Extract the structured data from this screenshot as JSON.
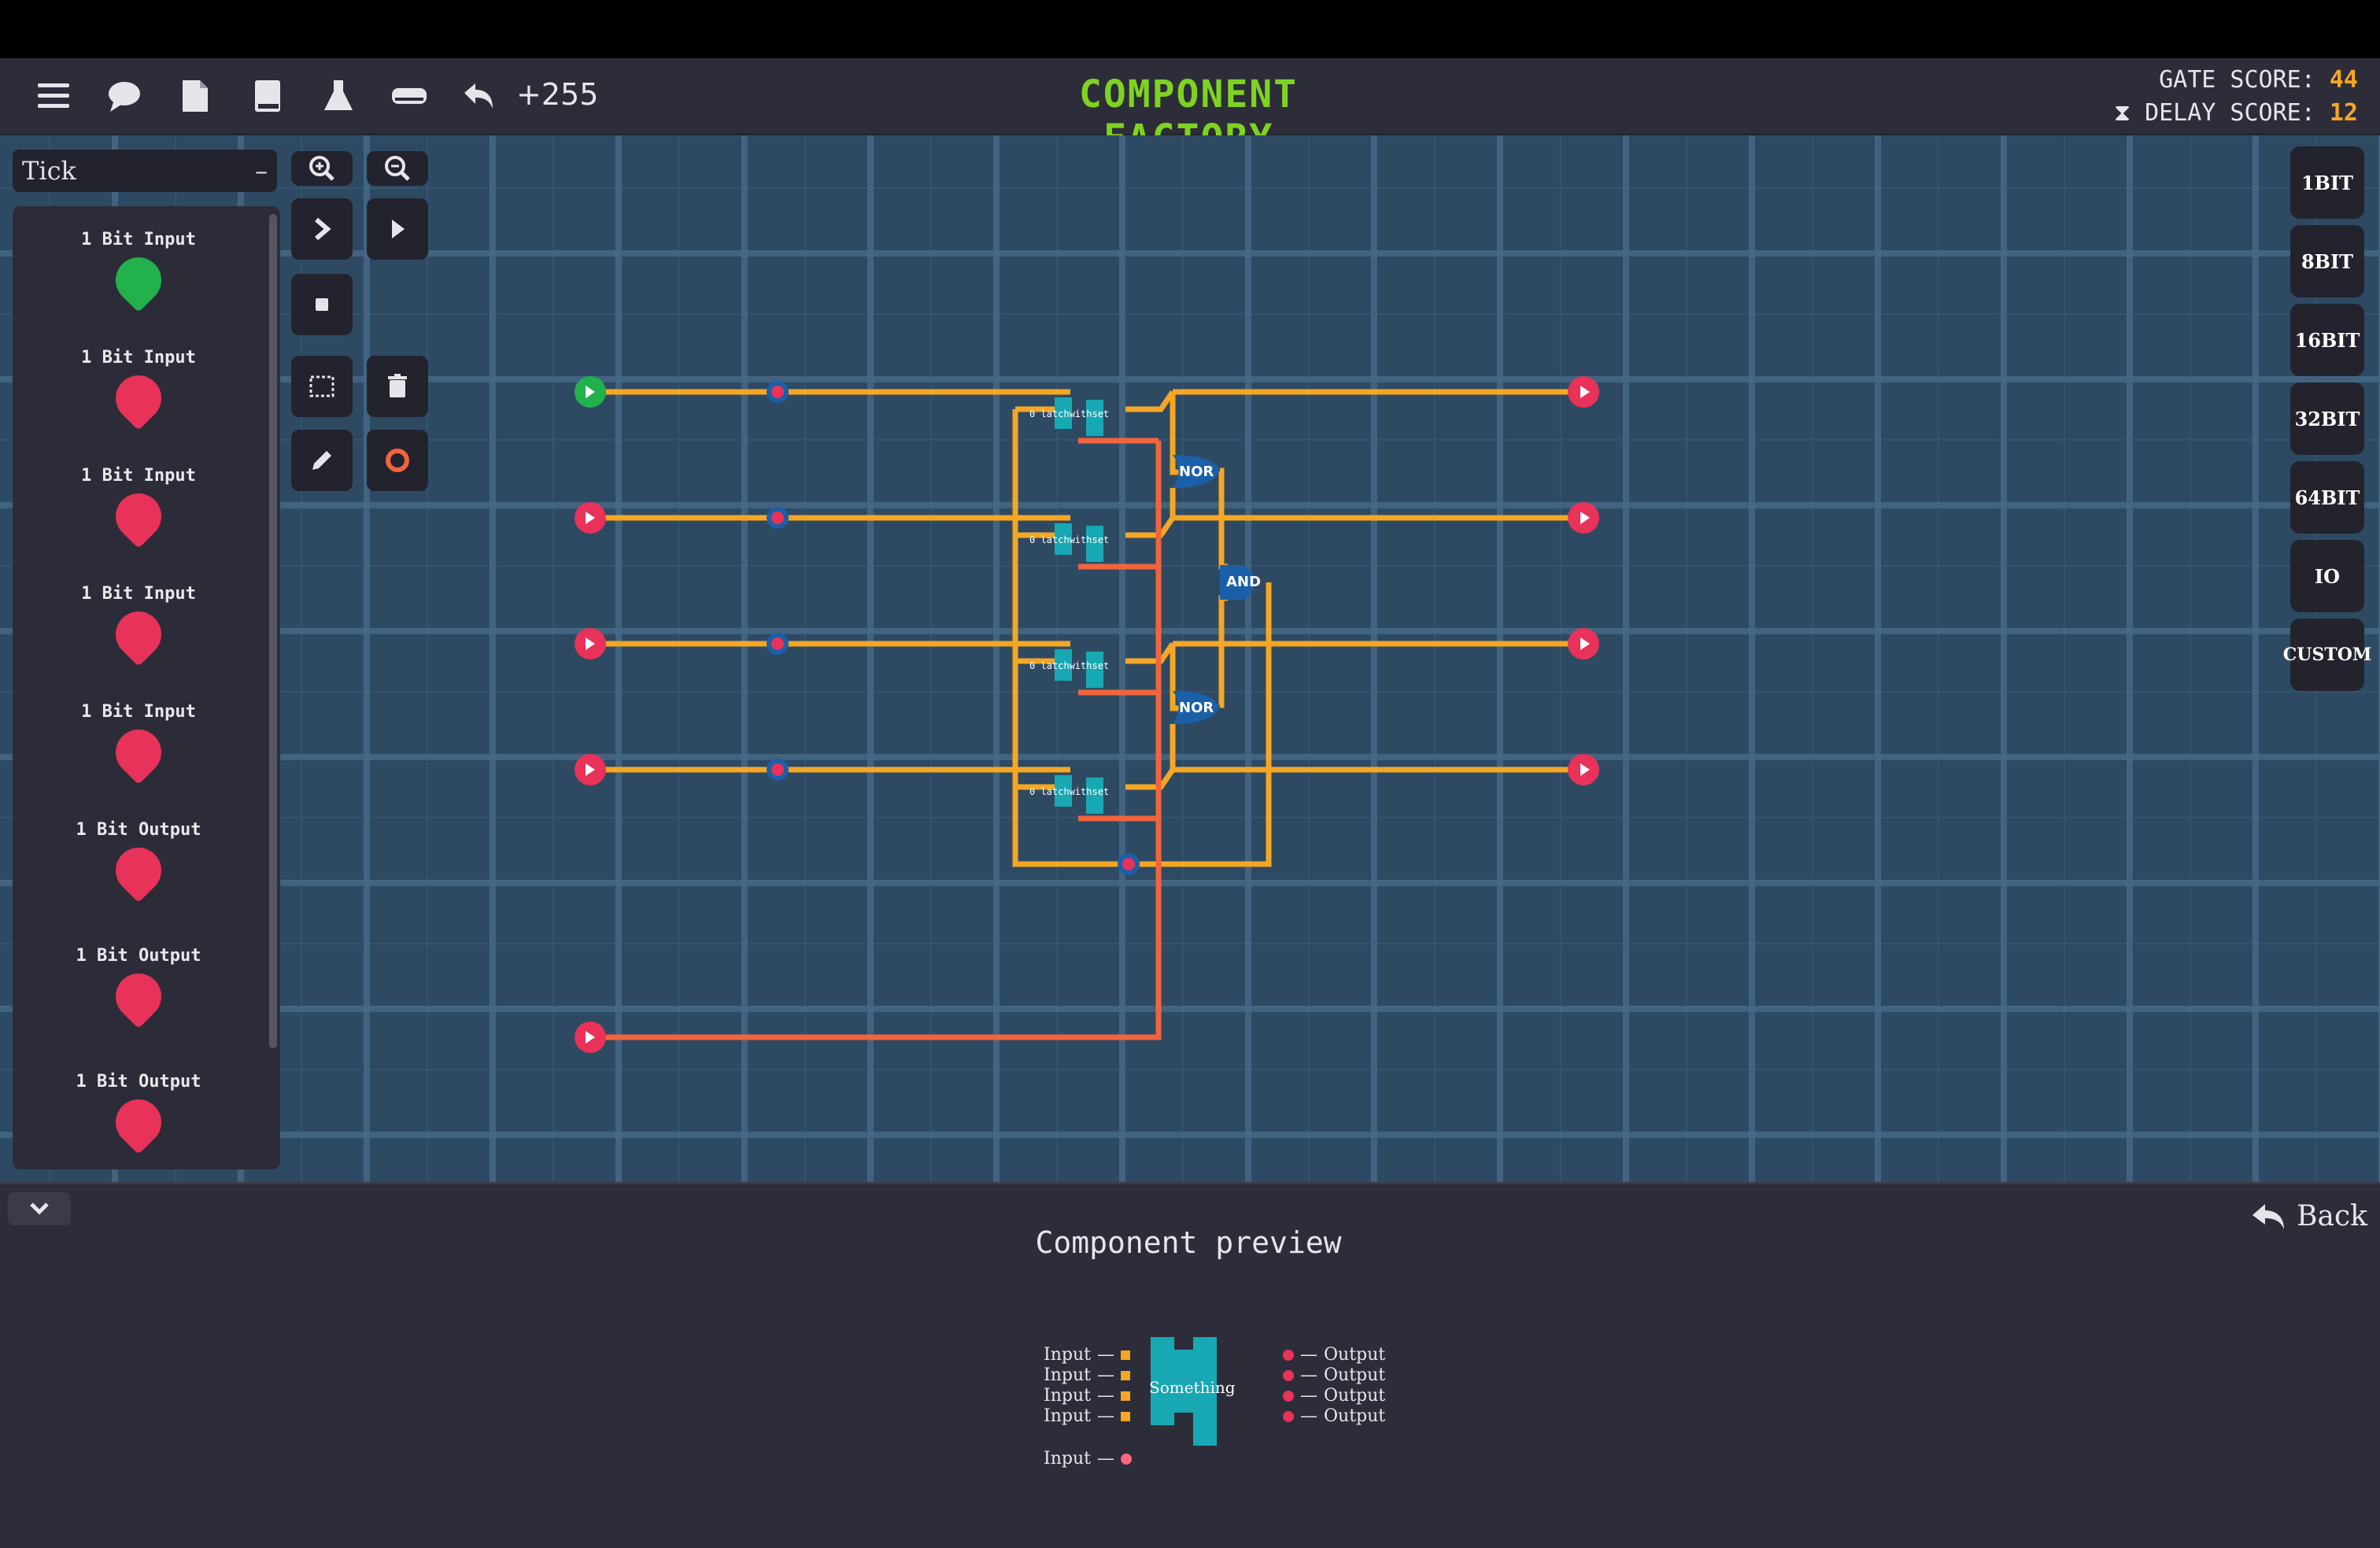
{
  "header": {
    "undo_count": "+255",
    "title": "COMPONENT FACTORY",
    "gate_score_label": "GATE SCORE:",
    "gate_score_value": "44",
    "delay_score_label": "DELAY SCORE:",
    "delay_score_value": "12"
  },
  "toolbar_icons": [
    "menu-icon",
    "chat-icon",
    "file-icon",
    "book-icon",
    "flask-icon",
    "keyboard-icon",
    "undo-icon"
  ],
  "sidebar": {
    "tick_select": "Tick",
    "tick_toggle": "–",
    "palette": [
      {
        "label": "1 Bit Input",
        "state": "on"
      },
      {
        "label": "1 Bit Input",
        "state": "off"
      },
      {
        "label": "1 Bit Input",
        "state": "off"
      },
      {
        "label": "1 Bit Input",
        "state": "off"
      },
      {
        "label": "1 Bit Input",
        "state": "off"
      },
      {
        "label": "1 Bit Output",
        "state": "off"
      },
      {
        "label": "1 Bit Output",
        "state": "off"
      },
      {
        "label": "1 Bit Output",
        "state": "off"
      }
    ]
  },
  "right_buttons": [
    "1BIT",
    "8BIT",
    "16BIT",
    "32BIT",
    "64BIT",
    "IO",
    "CUSTOM"
  ],
  "circuit": {
    "latch_label": "0 latchwithset",
    "gates": [
      "NOR",
      "AND",
      "NOR"
    ]
  },
  "bottom": {
    "preview_title": "Component preview",
    "back_label": "Back",
    "component_name": "Something",
    "inputs": [
      "Input",
      "Input",
      "Input",
      "Input"
    ],
    "outputs": [
      "Output",
      "Output",
      "Output",
      "Output"
    ],
    "extra_input": "Input"
  },
  "colors": {
    "wire_orange": "#f5a623",
    "wire_red": "#f2643c",
    "title_green": "#7ed321",
    "input_on": "#22b14c",
    "input_off": "#e8325a"
  }
}
